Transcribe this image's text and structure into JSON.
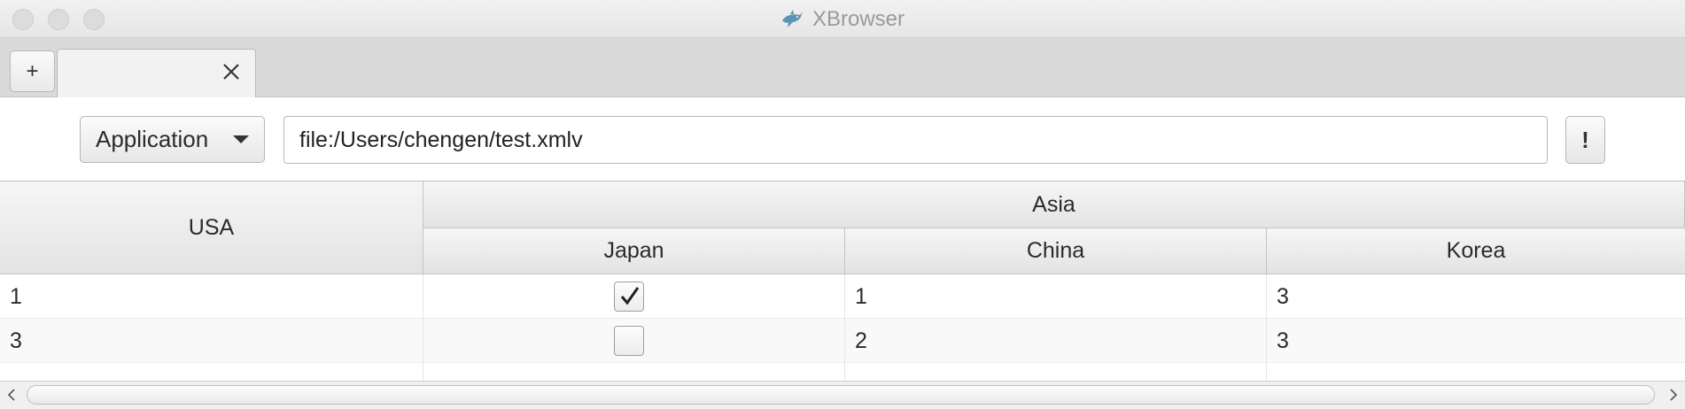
{
  "window": {
    "title": "XBrowser"
  },
  "tabbar": {
    "add_label": "+",
    "tabs": [
      {
        "label": ""
      }
    ]
  },
  "toolbar": {
    "type_select": {
      "selected": "Application"
    },
    "url": {
      "value": "file:/Users/chengen/test.xmlv"
    },
    "go_label": "!"
  },
  "table": {
    "headers": {
      "usa": "USA",
      "asia": "Asia",
      "japan": "Japan",
      "china": "China",
      "korea": "Korea"
    },
    "rows": [
      {
        "usa": "1",
        "japan_checked": true,
        "china": "1",
        "korea": "3"
      },
      {
        "usa": "3",
        "japan_checked": false,
        "china": "2",
        "korea": "3"
      }
    ]
  },
  "icons": {
    "app": "shark-icon",
    "tab_close": "close-icon",
    "select_caret": "chevron-down-icon",
    "checkmark": "check-icon",
    "scroll_left": "arrow-left-icon",
    "scroll_right": "arrow-right-icon"
  }
}
